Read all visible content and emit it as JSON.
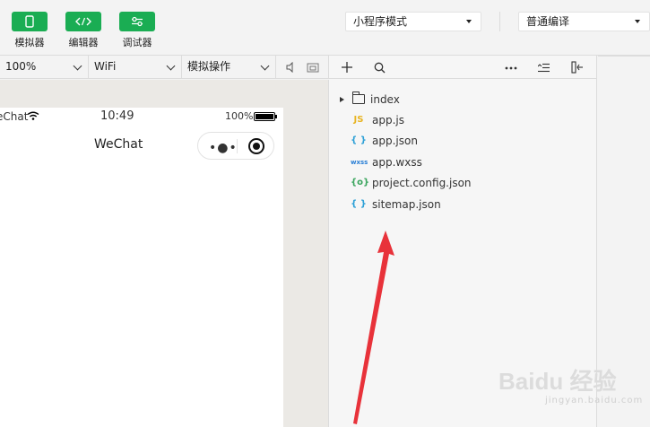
{
  "toolbar": {
    "tools": [
      {
        "label": "模拟器",
        "icon": "phone-icon"
      },
      {
        "label": "编辑器",
        "icon": "code-icon"
      },
      {
        "label": "调试器",
        "icon": "debug-icon"
      }
    ],
    "mode_select": "小程序模式",
    "compile_select": "普通编译"
  },
  "subbar": {
    "zoom": "100%",
    "network": "WiFi",
    "operation": "模拟操作"
  },
  "phone": {
    "carrier": "eChat",
    "time": "10:49",
    "battery": "100%",
    "nav_title": "WeChat",
    "capsule_dots": "•●•"
  },
  "explorer": {
    "files": [
      {
        "name": "index",
        "type": "folder",
        "icon_text": ""
      },
      {
        "name": "app.js",
        "type": "js",
        "icon_text": "JS",
        "color": "#e8b422"
      },
      {
        "name": "app.json",
        "type": "json",
        "icon_text": "{ }",
        "color": "#2a9fd6"
      },
      {
        "name": "app.wxss",
        "type": "wxss",
        "icon_text": "wxss",
        "color": "#2a7fd6"
      },
      {
        "name": "project.config.json",
        "type": "config",
        "icon_text": "{o}",
        "color": "#3aa55d"
      },
      {
        "name": "sitemap.json",
        "type": "json",
        "icon_text": "{ }",
        "color": "#2a9fd6"
      }
    ]
  },
  "annotation_color": "#e8323a",
  "accent_color": "#1aad53",
  "watermark": {
    "main": "Baidu 经验",
    "sub": "jingyan.baidu.com"
  }
}
